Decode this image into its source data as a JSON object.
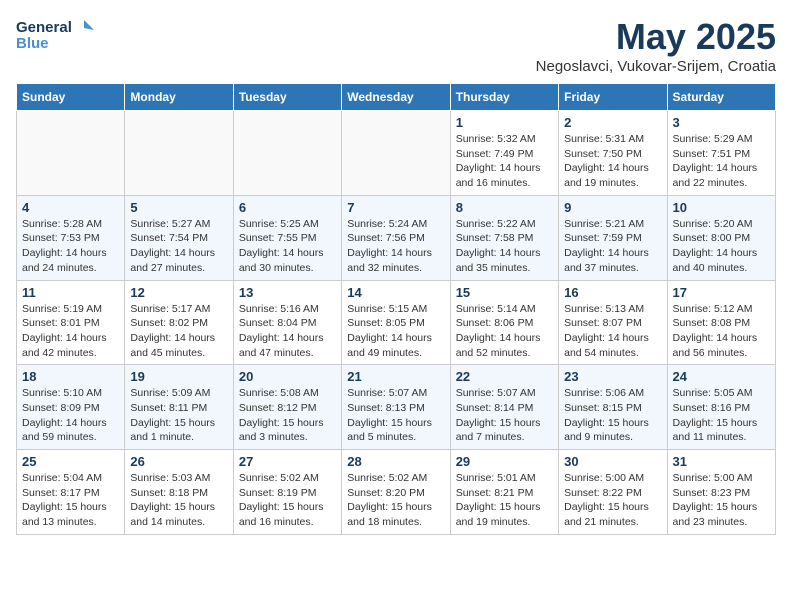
{
  "logo": {
    "line1": "General",
    "line2": "Blue"
  },
  "title": "May 2025",
  "subtitle": "Negoslavci, Vukovar-Srijem, Croatia",
  "days_of_week": [
    "Sunday",
    "Monday",
    "Tuesday",
    "Wednesday",
    "Thursday",
    "Friday",
    "Saturday"
  ],
  "weeks": [
    [
      {
        "day": "",
        "info": ""
      },
      {
        "day": "",
        "info": ""
      },
      {
        "day": "",
        "info": ""
      },
      {
        "day": "",
        "info": ""
      },
      {
        "day": "1",
        "info": "Sunrise: 5:32 AM\nSunset: 7:49 PM\nDaylight: 14 hours\nand 16 minutes."
      },
      {
        "day": "2",
        "info": "Sunrise: 5:31 AM\nSunset: 7:50 PM\nDaylight: 14 hours\nand 19 minutes."
      },
      {
        "day": "3",
        "info": "Sunrise: 5:29 AM\nSunset: 7:51 PM\nDaylight: 14 hours\nand 22 minutes."
      }
    ],
    [
      {
        "day": "4",
        "info": "Sunrise: 5:28 AM\nSunset: 7:53 PM\nDaylight: 14 hours\nand 24 minutes."
      },
      {
        "day": "5",
        "info": "Sunrise: 5:27 AM\nSunset: 7:54 PM\nDaylight: 14 hours\nand 27 minutes."
      },
      {
        "day": "6",
        "info": "Sunrise: 5:25 AM\nSunset: 7:55 PM\nDaylight: 14 hours\nand 30 minutes."
      },
      {
        "day": "7",
        "info": "Sunrise: 5:24 AM\nSunset: 7:56 PM\nDaylight: 14 hours\nand 32 minutes."
      },
      {
        "day": "8",
        "info": "Sunrise: 5:22 AM\nSunset: 7:58 PM\nDaylight: 14 hours\nand 35 minutes."
      },
      {
        "day": "9",
        "info": "Sunrise: 5:21 AM\nSunset: 7:59 PM\nDaylight: 14 hours\nand 37 minutes."
      },
      {
        "day": "10",
        "info": "Sunrise: 5:20 AM\nSunset: 8:00 PM\nDaylight: 14 hours\nand 40 minutes."
      }
    ],
    [
      {
        "day": "11",
        "info": "Sunrise: 5:19 AM\nSunset: 8:01 PM\nDaylight: 14 hours\nand 42 minutes."
      },
      {
        "day": "12",
        "info": "Sunrise: 5:17 AM\nSunset: 8:02 PM\nDaylight: 14 hours\nand 45 minutes."
      },
      {
        "day": "13",
        "info": "Sunrise: 5:16 AM\nSunset: 8:04 PM\nDaylight: 14 hours\nand 47 minutes."
      },
      {
        "day": "14",
        "info": "Sunrise: 5:15 AM\nSunset: 8:05 PM\nDaylight: 14 hours\nand 49 minutes."
      },
      {
        "day": "15",
        "info": "Sunrise: 5:14 AM\nSunset: 8:06 PM\nDaylight: 14 hours\nand 52 minutes."
      },
      {
        "day": "16",
        "info": "Sunrise: 5:13 AM\nSunset: 8:07 PM\nDaylight: 14 hours\nand 54 minutes."
      },
      {
        "day": "17",
        "info": "Sunrise: 5:12 AM\nSunset: 8:08 PM\nDaylight: 14 hours\nand 56 minutes."
      }
    ],
    [
      {
        "day": "18",
        "info": "Sunrise: 5:10 AM\nSunset: 8:09 PM\nDaylight: 14 hours\nand 59 minutes."
      },
      {
        "day": "19",
        "info": "Sunrise: 5:09 AM\nSunset: 8:11 PM\nDaylight: 15 hours\nand 1 minute."
      },
      {
        "day": "20",
        "info": "Sunrise: 5:08 AM\nSunset: 8:12 PM\nDaylight: 15 hours\nand 3 minutes."
      },
      {
        "day": "21",
        "info": "Sunrise: 5:07 AM\nSunset: 8:13 PM\nDaylight: 15 hours\nand 5 minutes."
      },
      {
        "day": "22",
        "info": "Sunrise: 5:07 AM\nSunset: 8:14 PM\nDaylight: 15 hours\nand 7 minutes."
      },
      {
        "day": "23",
        "info": "Sunrise: 5:06 AM\nSunset: 8:15 PM\nDaylight: 15 hours\nand 9 minutes."
      },
      {
        "day": "24",
        "info": "Sunrise: 5:05 AM\nSunset: 8:16 PM\nDaylight: 15 hours\nand 11 minutes."
      }
    ],
    [
      {
        "day": "25",
        "info": "Sunrise: 5:04 AM\nSunset: 8:17 PM\nDaylight: 15 hours\nand 13 minutes."
      },
      {
        "day": "26",
        "info": "Sunrise: 5:03 AM\nSunset: 8:18 PM\nDaylight: 15 hours\nand 14 minutes."
      },
      {
        "day": "27",
        "info": "Sunrise: 5:02 AM\nSunset: 8:19 PM\nDaylight: 15 hours\nand 16 minutes."
      },
      {
        "day": "28",
        "info": "Sunrise: 5:02 AM\nSunset: 8:20 PM\nDaylight: 15 hours\nand 18 minutes."
      },
      {
        "day": "29",
        "info": "Sunrise: 5:01 AM\nSunset: 8:21 PM\nDaylight: 15 hours\nand 19 minutes."
      },
      {
        "day": "30",
        "info": "Sunrise: 5:00 AM\nSunset: 8:22 PM\nDaylight: 15 hours\nand 21 minutes."
      },
      {
        "day": "31",
        "info": "Sunrise: 5:00 AM\nSunset: 8:23 PM\nDaylight: 15 hours\nand 23 minutes."
      }
    ]
  ]
}
